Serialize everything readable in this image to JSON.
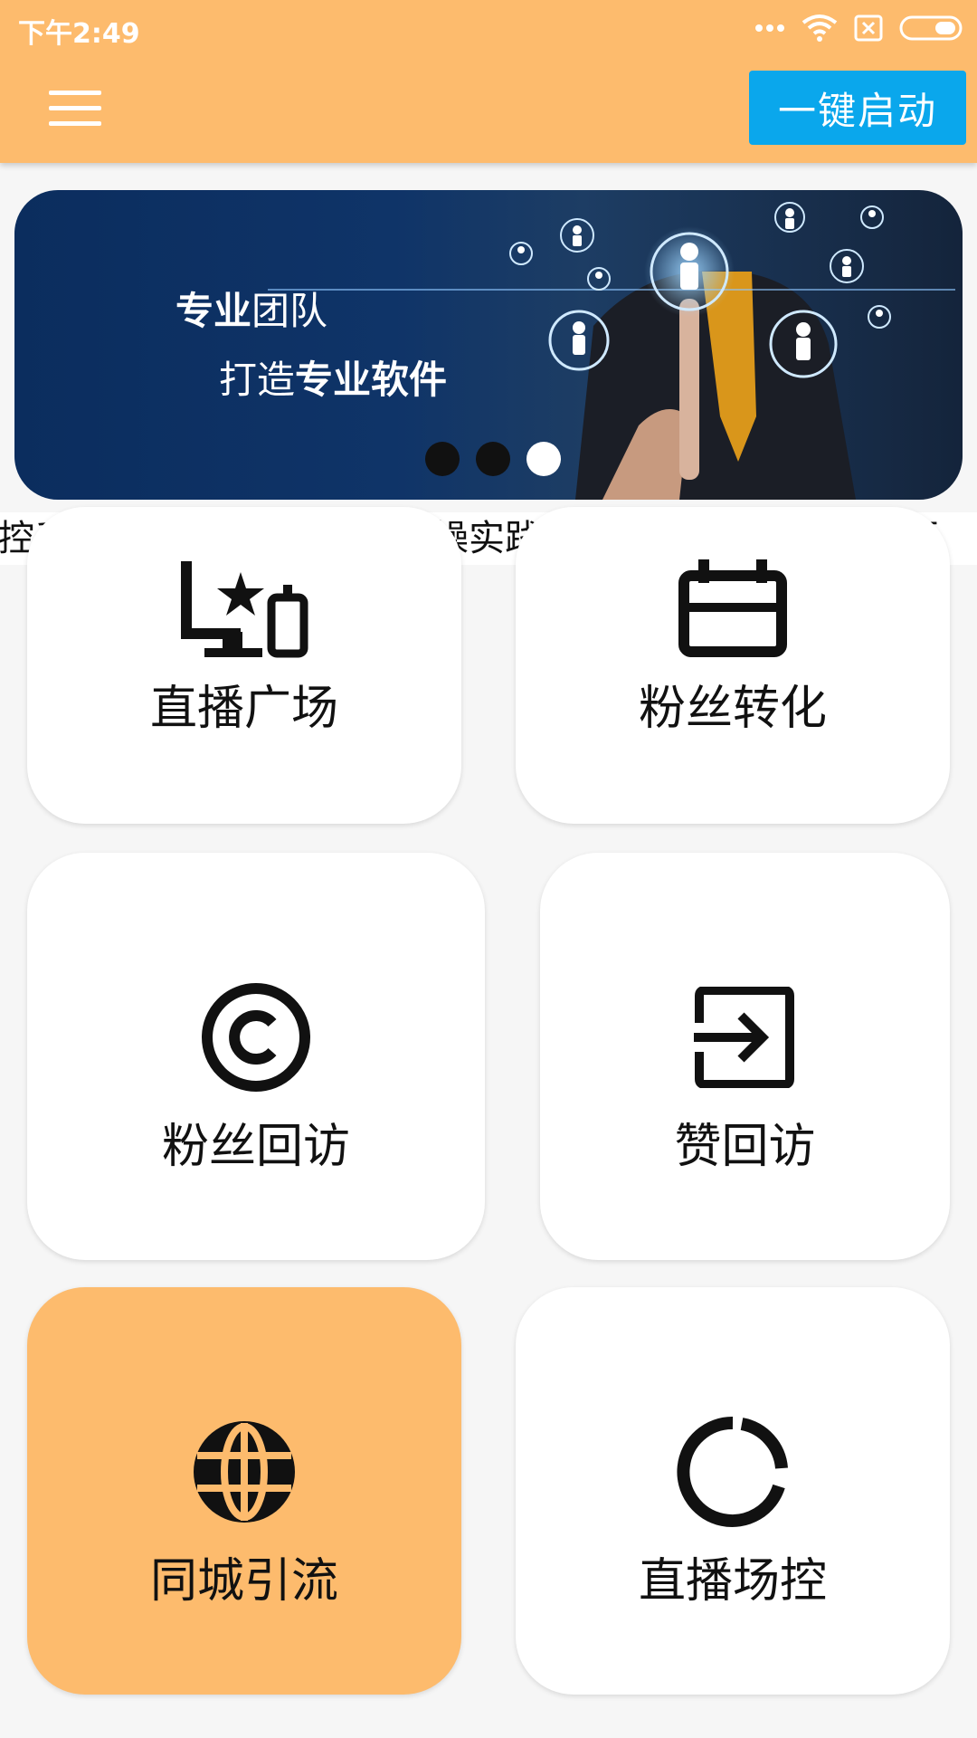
{
  "status_bar": {
    "time": "下午2:49"
  },
  "header": {
    "menu_icon": "hamburger-icon",
    "start_button": "一键启动"
  },
  "banner": {
    "line1_bold": "专业",
    "line1_regular": "团队",
    "line2_regular": "打造",
    "line2_bold": "专业软件",
    "indicator": {
      "count": 3,
      "active_index": 2
    }
  },
  "marquee": {
    "text": "场控系统是通过时间沉淀，实操实践开发的一款软件，因此更"
  },
  "tiles": [
    {
      "label": "直播广场",
      "icon": "live-broadcast-icon"
    },
    {
      "label": "粉丝转化",
      "icon": "calendar-icon"
    },
    {
      "label": "粉丝回访",
      "icon": "copyright-icon"
    },
    {
      "label": "赞回访",
      "icon": "exit-to-app-icon"
    },
    {
      "label": "同城引流",
      "icon": "globe-icon"
    },
    {
      "label": "直播场控",
      "icon": "donut-ring-icon"
    }
  ],
  "colors": {
    "header": "#fdbb6d",
    "start_button": "#0aa7ec",
    "highlight_tile": "#fdbb6d"
  }
}
